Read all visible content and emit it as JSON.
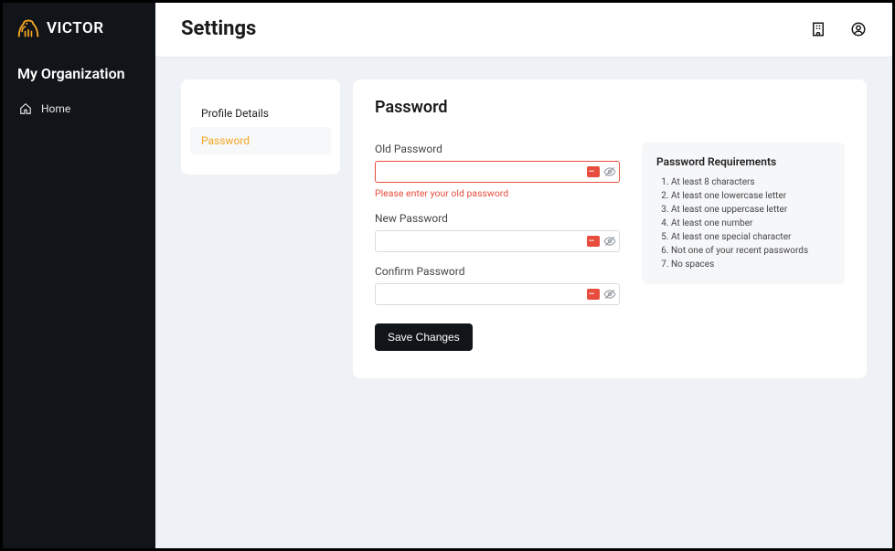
{
  "brand": {
    "name": "VICTOR"
  },
  "sidebar": {
    "org_title": "My Organization",
    "nav": [
      {
        "label": "Home"
      }
    ]
  },
  "header": {
    "title": "Settings"
  },
  "tabs": [
    {
      "label": "Profile Details",
      "active": false
    },
    {
      "label": "Password",
      "active": true
    }
  ],
  "password_panel": {
    "title": "Password",
    "fields": {
      "old": {
        "label": "Old Password",
        "value": "",
        "error": "Please enter your old password"
      },
      "new": {
        "label": "New Password",
        "value": ""
      },
      "confirm": {
        "label": "Confirm Password",
        "value": ""
      }
    },
    "save_label": "Save Changes",
    "requirements": {
      "title": "Password Requirements",
      "items": [
        "At least 8 characters",
        "At least one lowercase letter",
        "At least one uppercase letter",
        "At least one number",
        "At least one special character",
        "Not one of your recent passwords",
        "No spaces"
      ]
    }
  }
}
